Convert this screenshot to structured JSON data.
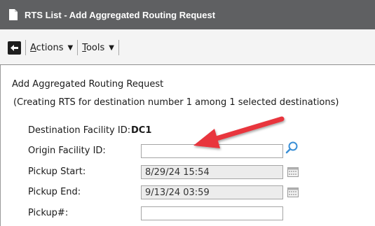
{
  "window": {
    "title": "RTS List - Add Aggregated Routing Request"
  },
  "toolbar": {
    "actions_label": "Actions",
    "actions_hotkey": "A",
    "actions_rest": "ctions",
    "tools_label": "Tools",
    "tools_hotkey": "T",
    "tools_rest": "ools"
  },
  "form": {
    "heading": "Add Aggregated Routing Request",
    "subheading": "(Creating RTS for destination number 1 among 1 selected destinations)",
    "destination_label": "Destination Facility ID:",
    "destination_value": "DC1",
    "origin_label": "Origin Facility ID:",
    "origin_value": "",
    "pickup_start_label": "Pickup Start:",
    "pickup_start_value": "8/29/24 15:54",
    "pickup_end_label": "Pickup End:",
    "pickup_end_value": "9/13/24 03:59",
    "pickup_num_label": "Pickup#:",
    "pickup_num_value": ""
  },
  "icons": {
    "title": "document-icon",
    "back": "back-arrow-icon",
    "search": "search-icon",
    "calendar": "calendar-icon",
    "annotation": "red-arrow-annotation"
  },
  "colors": {
    "titlebar": "#5f6062",
    "annotation_arrow": "#e8343c",
    "search_icon": "#3a8fd6"
  }
}
